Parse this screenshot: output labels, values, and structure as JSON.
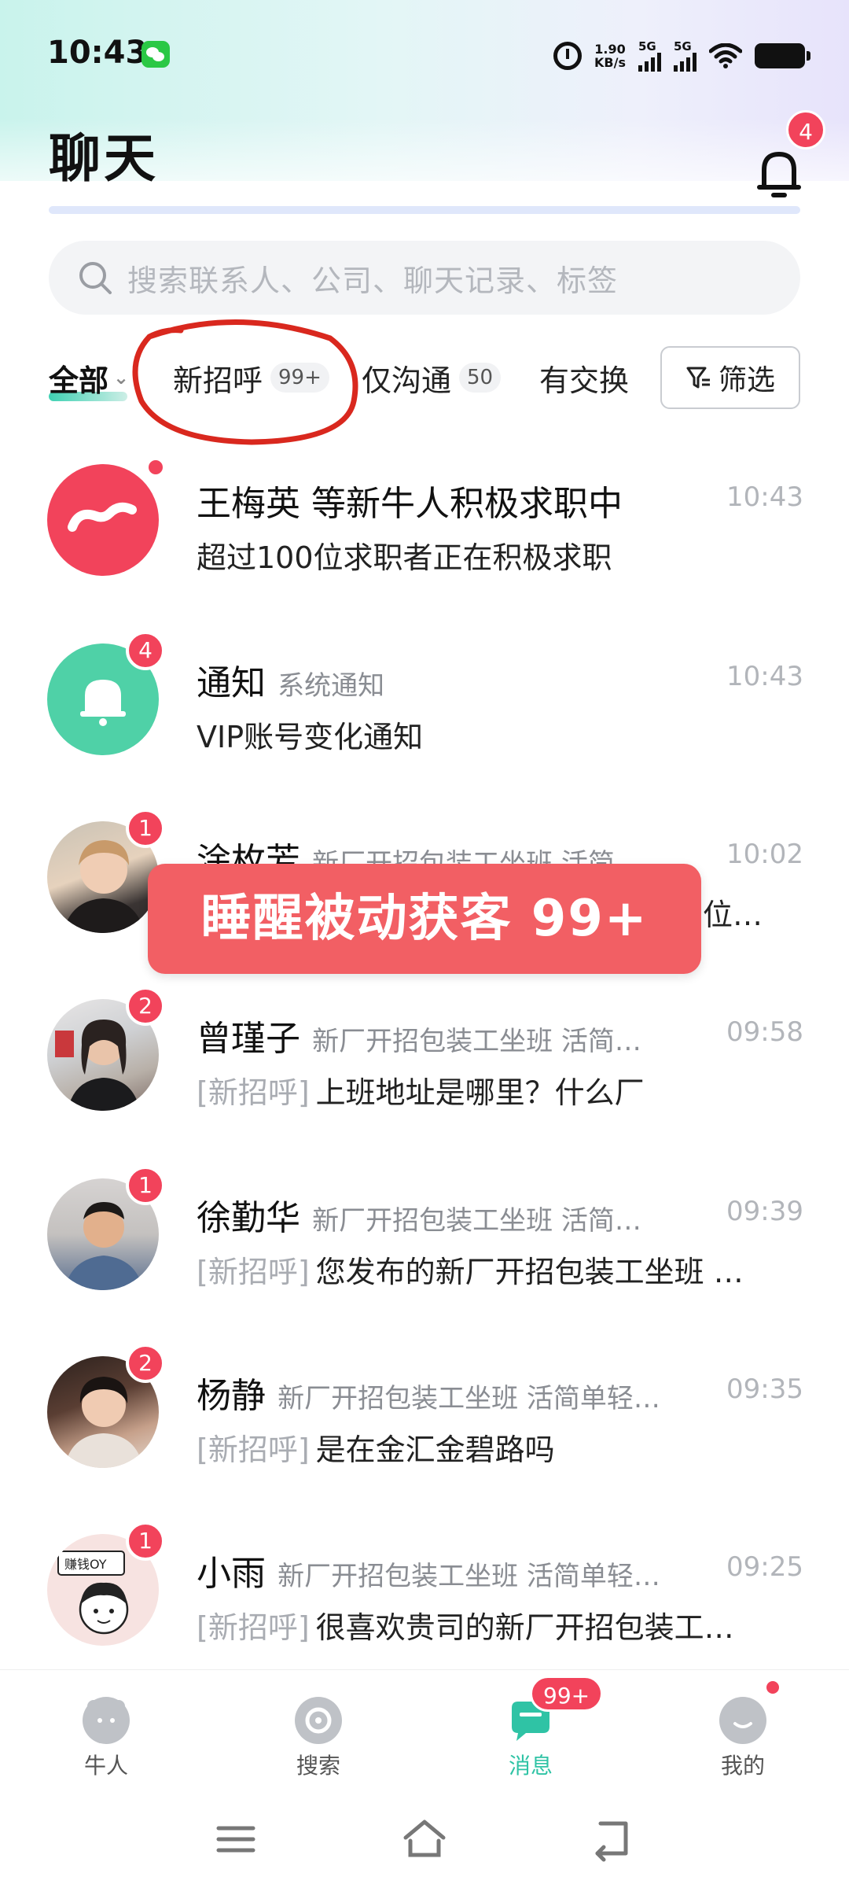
{
  "status_bar": {
    "time": "10:43",
    "net_speed_value": "1.90",
    "net_speed_unit": "KB/s",
    "signal1": "5G",
    "signal2": "5G"
  },
  "header": {
    "title": "聊天",
    "notification_count": "4"
  },
  "search": {
    "placeholder": "搜索联系人、公司、聊天记录、标签"
  },
  "tabs": [
    {
      "label": "全部",
      "count": ""
    },
    {
      "label": "新招呼",
      "count": "99+"
    },
    {
      "label": "仅沟通",
      "count": "50"
    },
    {
      "label": "有交换",
      "count": ""
    }
  ],
  "filter": {
    "label": "筛选"
  },
  "chats": [
    {
      "name": "王梅英 等新牛人积极求职中",
      "subtitle": "",
      "time": "10:43",
      "tag": "",
      "preview": "超过100位求职者正在积极求职",
      "badge": ""
    },
    {
      "name": "通知",
      "subtitle": "系统通知",
      "time": "10:43",
      "tag": "",
      "preview": "VIP账号变化通知",
      "badge": "4"
    },
    {
      "name": "涂枚芳",
      "subtitle": "新厂开招包装工坐班 活简…",
      "time": "10:02",
      "tag": "",
      "preview": "…岗位…",
      "badge": "1"
    },
    {
      "name": "曾瑾子",
      "subtitle": "新厂开招包装工坐班 活简…",
      "time": "09:58",
      "tag": "[新招呼]",
      "preview": "上班地址是哪里？什么厂",
      "badge": "2"
    },
    {
      "name": "徐勤华",
      "subtitle": "新厂开招包装工坐班 活简…",
      "time": "09:39",
      "tag": "[新招呼]",
      "preview": "您发布的新厂开招包装工坐班 …",
      "badge": "1"
    },
    {
      "name": "杨静",
      "subtitle": "新厂开招包装工坐班 活简单轻…",
      "time": "09:35",
      "tag": "[新招呼]",
      "preview": "是在金汇金碧路吗",
      "badge": "2"
    },
    {
      "name": "小雨",
      "subtitle": "新厂开招包装工坐班 活简单轻…",
      "time": "09:25",
      "tag": "[新招呼]",
      "preview": "很喜欢贵司的新厂开招包装工…",
      "badge": "1"
    }
  ],
  "banner": {
    "text": "睡醒被动获客 99+"
  },
  "avatar_texts": {
    "xiaoyu_sign": "赚钱OY"
  },
  "bottom_nav": [
    {
      "label": "牛人",
      "icon": "bear-icon"
    },
    {
      "label": "搜索",
      "icon": "search-disc-icon"
    },
    {
      "label": "消息",
      "icon": "message-icon",
      "badge": "99+"
    },
    {
      "label": "我的",
      "icon": "profile-icon"
    }
  ],
  "colors": {
    "accent": "#2fc3a5",
    "badge_red": "#f2435b",
    "banner": "#f25f64"
  }
}
